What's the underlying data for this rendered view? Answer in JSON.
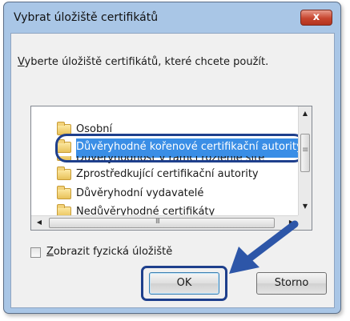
{
  "window": {
    "title": "Vybrat úložiště certifikátů",
    "close_label": "x"
  },
  "instruction": {
    "prefix": "V",
    "rest": "yberte úložiště certifikátů, které chcete použít."
  },
  "store_list": {
    "items": [
      {
        "label": "Osobní",
        "selected": false
      },
      {
        "label": "Důvěryhodné kořenové certifikační autority",
        "selected": true
      },
      {
        "label": "Důvěryhodnost v rámci rozlehlé sítě",
        "selected": false
      },
      {
        "label": "Zprostředkující certifikační autority",
        "selected": false
      },
      {
        "label": "Důvěryhodní vydavatelé",
        "selected": false
      },
      {
        "label": "Nedůvěryhodné certifikáty",
        "selected": false
      }
    ]
  },
  "show_physical": {
    "prefix": "Z",
    "rest": "obrazit fyzická úložiště",
    "checked": false
  },
  "buttons": {
    "ok_label": "OK",
    "cancel_label": "Storno"
  },
  "colors": {
    "selection": "#3a8ee6",
    "highlight": "#1e3f8c",
    "arrow": "#2d56a8"
  }
}
